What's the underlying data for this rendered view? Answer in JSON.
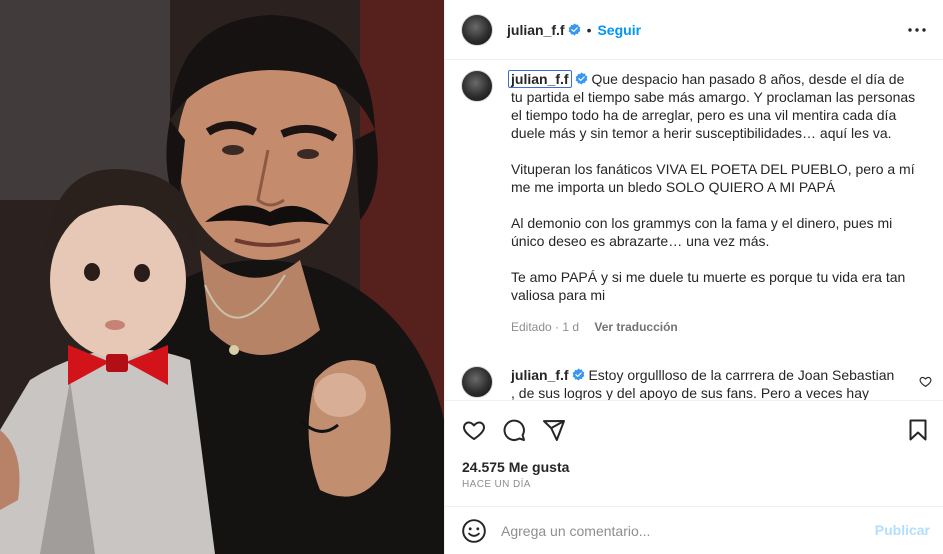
{
  "post": {
    "username": "julian_f.f",
    "separator": "•",
    "follow_label": "Seguir"
  },
  "caption": {
    "username": "julian_f.f",
    "paragraphs": [
      "Que despacio han pasado 8 años, desde el día de tu partida el tiempo sabe más amargo. Y proclaman las personas el tiempo todo ha de arreglar, pero es una vil mentira cada día duele más y sin temor a herir susceptibilidades… aquí les va.",
      "Vituperan los fanáticos VIVA EL POETA DEL PUEBLO, pero a mí me me importa un bledo SOLO QUIERO A MI PAPÁ",
      "Al demonio con los grammys con la fama y el dinero, pues mi único deseo es abrazarte… una vez más.",
      "Te amo PAPÁ y si me duele tu muerte es porque tu vida era tan valiosa para mi"
    ],
    "edited": "Editado · 1 d",
    "translate_label": "Ver traducción"
  },
  "reply": {
    "username": "julian_f.f",
    "text": "Estoy orgullloso de la carrrera de Joan Sebastian , de sus logros y del apoyo de sus fans. Pero a veces hay"
  },
  "stats": {
    "likes": "24.575 Me gusta",
    "time": "HACE UN DÍA"
  },
  "comment_box": {
    "placeholder": "Agrega un comentario...",
    "publish_label": "Publicar"
  },
  "icons": {
    "verified": "verified-badge-icon",
    "more": "more-options-icon",
    "like": "heart-icon",
    "comment": "comment-bubble-icon",
    "share": "paper-plane-icon",
    "save": "bookmark-icon",
    "emoji": "emoji-smile-icon"
  },
  "colors": {
    "accent": "#0095f6",
    "verified": "#3897f0",
    "muted": "#8e8e8e",
    "publish_disabled": "#b2dffc"
  }
}
